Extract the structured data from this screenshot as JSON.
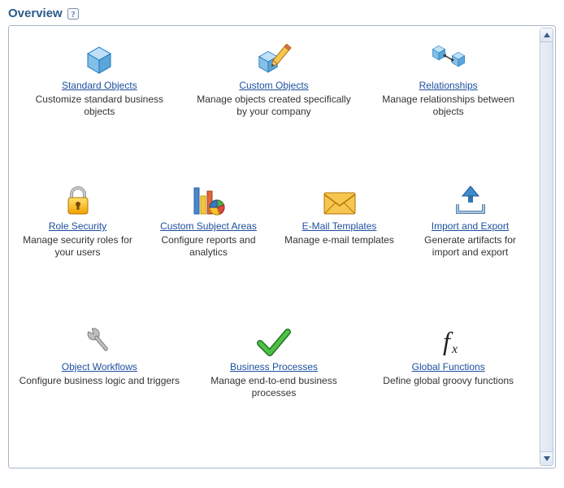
{
  "panel": {
    "title": "Overview"
  },
  "tiles": [
    {
      "id": "standard-objects",
      "title": "Standard Objects",
      "desc": "Customize standard business objects"
    },
    {
      "id": "custom-objects",
      "title": "Custom Objects",
      "desc": "Manage objects created specifically by your company"
    },
    {
      "id": "relationships",
      "title": "Relationships",
      "desc": "Manage relationships between objects"
    },
    {
      "id": "role-security",
      "title": "Role Security",
      "desc": "Manage security roles for your users"
    },
    {
      "id": "custom-subject-areas",
      "title": "Custom Subject Areas",
      "desc": "Configure reports and analytics"
    },
    {
      "id": "email-templates",
      "title": "E-Mail Templates",
      "desc": "Manage e-mail templates"
    },
    {
      "id": "import-export",
      "title": "Import and Export",
      "desc": "Generate artifacts for import and export"
    },
    {
      "id": "object-workflows",
      "title": "Object Workflows",
      "desc": "Configure business logic and triggers"
    },
    {
      "id": "business-processes",
      "title": "Business Processes",
      "desc": "Manage end-to-end business processes"
    },
    {
      "id": "global-functions",
      "title": "Global Functions",
      "desc": "Define global groovy functions"
    }
  ]
}
